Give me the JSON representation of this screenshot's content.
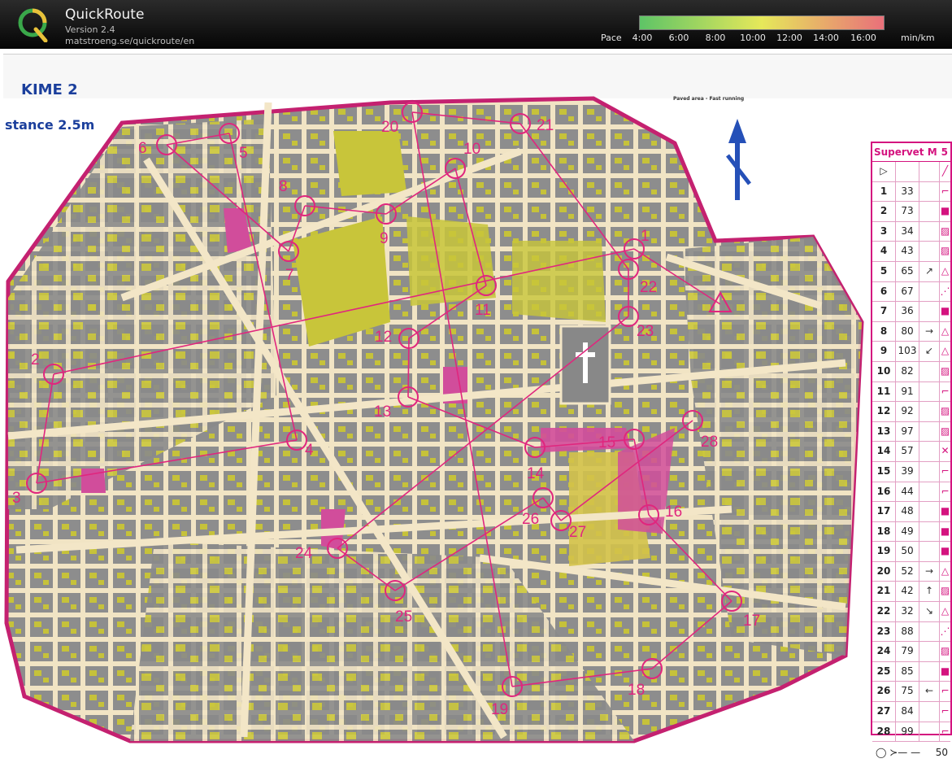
{
  "app": {
    "name": "QuickRoute",
    "version": "Version 2.4",
    "url": "matstroeng.se/quickroute/en"
  },
  "pace_scale": {
    "label": "Pace",
    "ticks": [
      "4:00",
      "6:00",
      "8:00",
      "10:00",
      "12:00",
      "14:00",
      "16:00"
    ],
    "unit": "min/km",
    "colors": {
      "fast": "#5ec466",
      "mid": "#e6e85a",
      "slow": "#e9707a"
    }
  },
  "map": {
    "title_fragment": "stance 2.5m",
    "corner_fragment": "KIME 2",
    "legend_heading": "Paved area - Fast running",
    "colors": {
      "route": "#e0267e",
      "building": "#8c8c8c",
      "open": "#c9c638",
      "road": "#f3e6c7",
      "boundary": "#c42170"
    },
    "controls": [
      {
        "n": "1",
        "code": "33"
      },
      {
        "n": "2",
        "code": "73"
      },
      {
        "n": "3",
        "code": "34"
      },
      {
        "n": "4",
        "code": "43"
      },
      {
        "n": "5",
        "code": "65"
      },
      {
        "n": "6",
        "code": "67"
      },
      {
        "n": "7",
        "code": "36"
      },
      {
        "n": "8",
        "code": "80"
      },
      {
        "n": "9",
        "code": "103"
      },
      {
        "n": "10",
        "code": "82"
      },
      {
        "n": "11",
        "code": "91"
      },
      {
        "n": "12",
        "code": "92"
      },
      {
        "n": "13",
        "code": "97"
      },
      {
        "n": "14",
        "code": "57"
      },
      {
        "n": "15",
        "code": "39"
      },
      {
        "n": "16",
        "code": "44"
      },
      {
        "n": "17",
        "code": "48"
      },
      {
        "n": "18",
        "code": "49"
      },
      {
        "n": "19",
        "code": "50"
      },
      {
        "n": "20",
        "code": "52"
      },
      {
        "n": "21",
        "code": "42"
      },
      {
        "n": "22",
        "code": "32"
      },
      {
        "n": "23",
        "code": "88"
      },
      {
        "n": "24",
        "code": "79"
      },
      {
        "n": "25",
        "code": "85"
      },
      {
        "n": "26",
        "code": "75"
      },
      {
        "n": "27",
        "code": "84"
      },
      {
        "n": "28",
        "code": "99"
      }
    ]
  },
  "legend": {
    "title": "Supervet M",
    "title_suffix": "5",
    "direction_symbols": [
      "",
      "",
      "",
      "",
      "↗",
      "",
      "",
      "→",
      "↙",
      "",
      "",
      "",
      "",
      "",
      "",
      "",
      "",
      "",
      "",
      "→",
      "↑",
      "↘",
      "",
      "",
      "",
      "←",
      "",
      ""
    ],
    "feature_symbols": [
      "⌐",
      "■",
      "▨",
      "▨",
      "△",
      "⋰",
      "■",
      "△",
      "△",
      "▨",
      "⌐",
      "▨",
      "▨",
      "✕",
      "⌐",
      "⌐",
      "■",
      "■",
      "■",
      "△",
      "▨",
      "△",
      "⋰",
      "▨",
      "■",
      "⌐",
      "⌐",
      "⌐"
    ],
    "footer_value": "50"
  }
}
